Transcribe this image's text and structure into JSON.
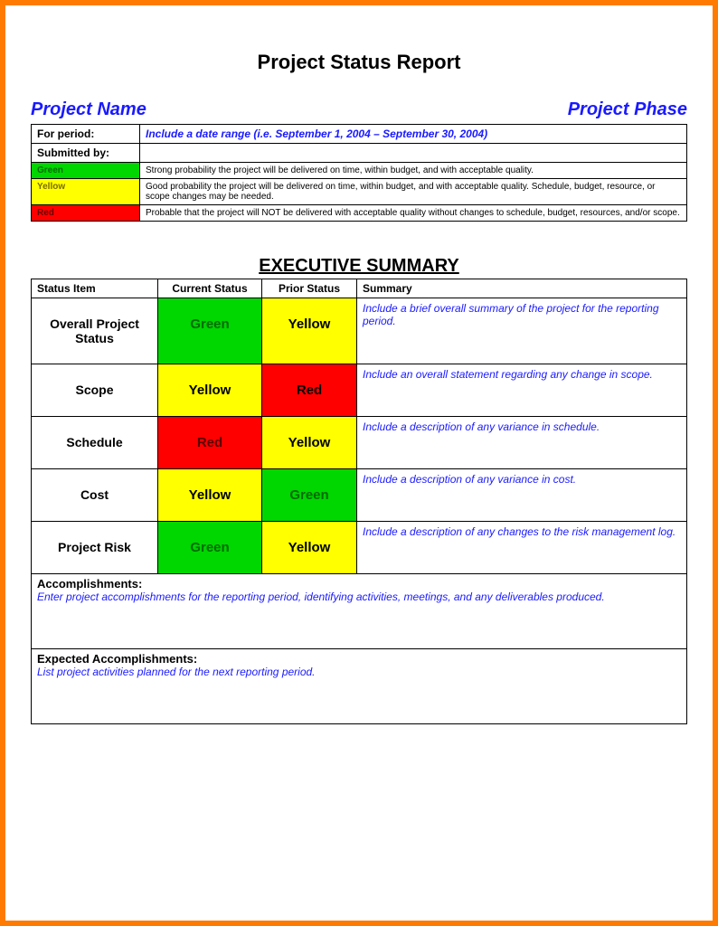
{
  "title": "Project Status Report",
  "top": {
    "project_name_label": "Project Name",
    "project_phase_label": "Project Phase"
  },
  "info": {
    "for_period_label": "For period:",
    "for_period_value": "Include a date range (i.e. September 1, 2004 – September 30, 2004)",
    "submitted_by_label": "Submitted by:"
  },
  "legend": [
    {
      "tag": "Green",
      "cls": "bg-green",
      "desc": "Strong probability the project will be delivered on time, within budget, and with acceptable quality."
    },
    {
      "tag": "Yellow",
      "cls": "bg-yellow",
      "desc": "Good probability the project will be delivered on time, within budget, and with acceptable quality. Schedule, budget, resource, or scope changes may be needed."
    },
    {
      "tag": "Red",
      "cls": "bg-red",
      "desc": "Probable that the project will NOT be delivered with acceptable quality without changes to schedule, budget, resources, and/or scope."
    }
  ],
  "executive_summary_title": "EXECUTIVE SUMMARY",
  "headers": {
    "status_item": "Status Item",
    "current": "Current Status",
    "prior": "Prior Status",
    "summary": "Summary"
  },
  "rows": [
    {
      "item": "Overall Project Status",
      "current": "Green",
      "current_cls": "cell-green",
      "prior": "Yellow",
      "prior_cls": "cell-yellow",
      "summary": "Include a brief overall summary of the project for the reporting period."
    },
    {
      "item": "Scope",
      "current": "Yellow",
      "current_cls": "cell-yellow",
      "prior": "Red",
      "prior_cls": "cell-red",
      "summary": "Include an overall statement regarding any change in scope."
    },
    {
      "item": "Schedule",
      "current": "Red",
      "current_cls": "cell-red-dark",
      "prior": "Yellow",
      "prior_cls": "cell-yellow",
      "summary": "Include a description of any variance in schedule."
    },
    {
      "item": "Cost",
      "current": "Yellow",
      "current_cls": "cell-yellow",
      "prior": "Green",
      "prior_cls": "cell-green",
      "summary": "Include a description of any variance in cost."
    },
    {
      "item": "Project Risk",
      "current": "Green",
      "current_cls": "cell-green",
      "prior": "Yellow",
      "prior_cls": "cell-yellow",
      "summary": "Include a description of any changes to the risk management log."
    }
  ],
  "sections": {
    "accomplishments_head": "Accomplishments:",
    "accomplishments_body": "Enter project accomplishments for the reporting period, identifying activities, meetings, and any deliverables produced.",
    "expected_head": "Expected Accomplishments:",
    "expected_body": "List project activities planned for the next reporting period."
  }
}
